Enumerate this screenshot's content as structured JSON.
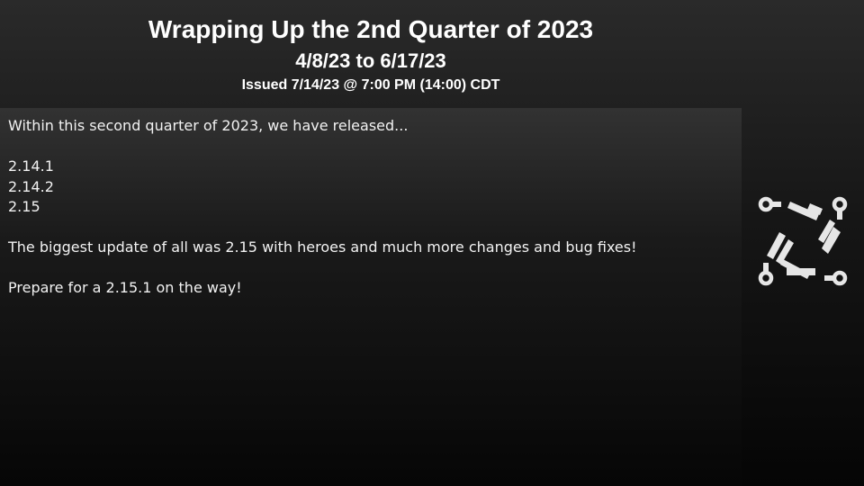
{
  "header": {
    "title": "Wrapping Up the 2nd Quarter of 2023",
    "date_range": "4/8/23 to 6/17/23",
    "issued": "Issued 7/14/23 @ 7:00 PM (14:00) CDT"
  },
  "body": {
    "intro": "Within this second quarter of 2023, we have released...",
    "releases": [
      "2.14.1",
      "2.14.2",
      "2.15"
    ],
    "highlight": "The biggest update of all was 2.15 with heroes and much more changes and bug fixes!",
    "closing": "Prepare for a 2.15.1 on the way!"
  },
  "logo": {
    "icon": "circuit-pinwheel-logo-icon",
    "color": "#e6e6e6"
  },
  "colors": {
    "text": "#ffffff",
    "body_text": "#f2f2f2",
    "background_top": "#2a2a2a",
    "background_bottom": "#050505"
  }
}
